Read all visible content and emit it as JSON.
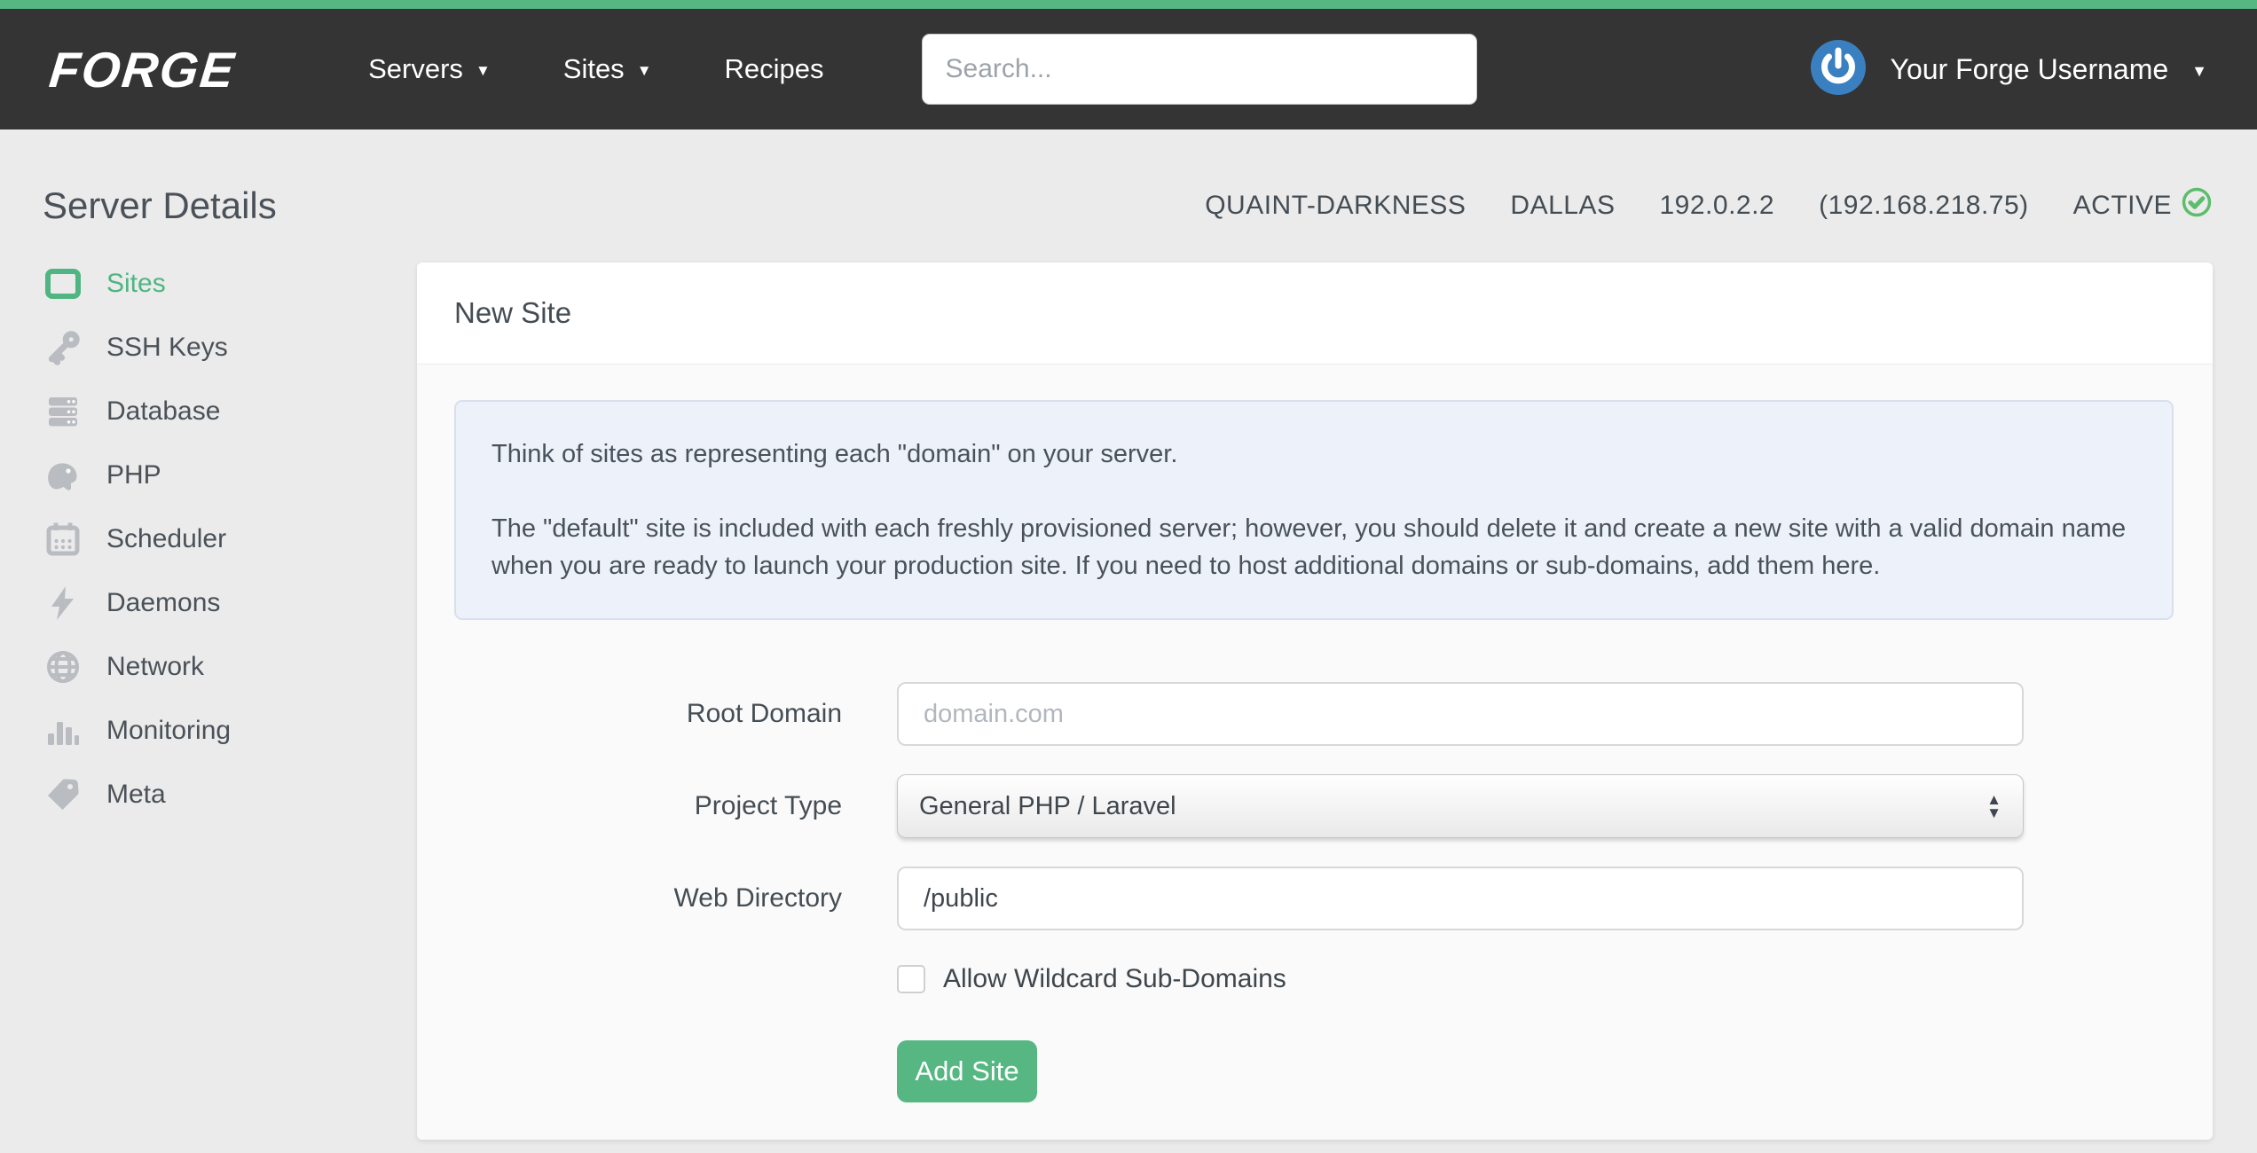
{
  "navbar": {
    "logo_text": "FORGE",
    "links": [
      {
        "label": "Servers",
        "caret": true
      },
      {
        "label": "Sites",
        "caret": true
      },
      {
        "label": "Recipes",
        "caret": false
      }
    ],
    "search": {
      "placeholder": "Search..."
    },
    "user": {
      "avatar_icon": "power-icon",
      "name": "Your Forge Username"
    }
  },
  "page": {
    "title": "Server Details"
  },
  "server_info": {
    "name": "QUAINT-DARKNESS",
    "region": "DALLAS",
    "public_ip": "192.0.2.2",
    "private_ip": "(192.168.218.75)",
    "status": "ACTIVE",
    "status_icon": "check-circle-icon"
  },
  "sidebar": {
    "items": [
      {
        "label": "Sites",
        "icon": "browser-window-icon",
        "active": true
      },
      {
        "label": "SSH Keys",
        "icon": "key-icon",
        "active": false
      },
      {
        "label": "Database",
        "icon": "database-stack-icon",
        "active": false
      },
      {
        "label": "PHP",
        "icon": "php-elephant-icon",
        "active": false
      },
      {
        "label": "Scheduler",
        "icon": "calendar-icon",
        "active": false
      },
      {
        "label": "Daemons",
        "icon": "lightning-bolt-icon",
        "active": false
      },
      {
        "label": "Network",
        "icon": "globe-icon",
        "active": false
      },
      {
        "label": "Monitoring",
        "icon": "bar-chart-icon",
        "active": false
      },
      {
        "label": "Meta",
        "icon": "tag-icon",
        "active": false
      }
    ]
  },
  "card": {
    "title": "New Site",
    "info_paragraphs": [
      "Think of sites as representing each \"domain\" on your server.",
      "The \"default\" site is included with each freshly provisioned server; however, you should delete it and create a new site with a valid domain name when you are ready to launch your production site. If you need to host additional domains or sub-domains, add them here."
    ],
    "form": {
      "root_domain_label": "Root Domain",
      "root_domain_placeholder": "domain.com",
      "project_type_label": "Project Type",
      "project_type_value": "General PHP / Laravel",
      "web_directory_label": "Web Directory",
      "web_directory_value": "/public",
      "wildcard_label": "Allow Wildcard Sub-Domains",
      "wildcard_checked": false,
      "submit_label": "Add Site"
    }
  },
  "colors": {
    "accent_green": "#56b783",
    "navbar_bg": "#343434",
    "page_bg": "#ebebeb",
    "card_bg": "#fafafa",
    "info_box_bg": "#edf1f9",
    "info_box_border": "#d9dfed",
    "text_dark": "#454d54",
    "icon_gray": "#b9bcc0",
    "status_green": "#5cbd6d",
    "avatar_blue": "#3a80c1"
  }
}
